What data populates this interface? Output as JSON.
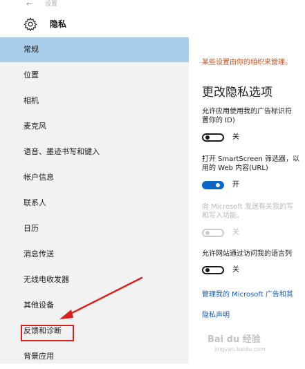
{
  "titlebar": {
    "back_glyph": "←",
    "title": "设置"
  },
  "header": {
    "icon": "gear-icon",
    "title": "隐私"
  },
  "sidebar": {
    "items": [
      {
        "label": "常规",
        "selected": true
      },
      {
        "label": "位置"
      },
      {
        "label": "相机"
      },
      {
        "label": "麦克风"
      },
      {
        "label": "语音、墨迹书写和键入"
      },
      {
        "label": "帐户信息"
      },
      {
        "label": "联系人"
      },
      {
        "label": "日历"
      },
      {
        "label": "消息传送"
      },
      {
        "label": "无线电收发器"
      },
      {
        "label": "其他设备"
      },
      {
        "label": "反馈和诊断",
        "highlighted": true
      },
      {
        "label": "背景应用"
      }
    ]
  },
  "main": {
    "org_note": "某些设置由你的组织来管理。",
    "section_title": "更改隐私选项",
    "options": [
      {
        "desc_line1": "允许应用使用我的广告标识符",
        "desc_line2": "置你的 ID)",
        "state": "关",
        "enabled": true,
        "on": false
      },
      {
        "desc_line1": "打开 SmartScreen 筛选器，以",
        "desc_line2": "用的 Web 内容(URL)",
        "state": "开",
        "enabled": true,
        "on": true
      },
      {
        "desc_line1": "向 Microsoft 发送有关我的写",
        "desc_line2": "和写入功能。",
        "state": "关",
        "enabled": false,
        "on": false
      },
      {
        "desc_line1": "允许网站通过访问我的语言列",
        "state": "关",
        "enabled": true,
        "on": false
      }
    ],
    "links": {
      "manage_ads": "管理我的 Microsoft 广告和其",
      "privacy_statement": "隐私声明"
    }
  },
  "watermark": {
    "logo_text": "Bai du 经验",
    "url": "jingyan.baidu.com"
  },
  "colors": {
    "sidebar_bg": "#f2f2f2",
    "selected_bg": "#a8cdeb",
    "accent": "#0a66c8",
    "org_note": "#c0521f",
    "annotation": "#d9201f"
  }
}
